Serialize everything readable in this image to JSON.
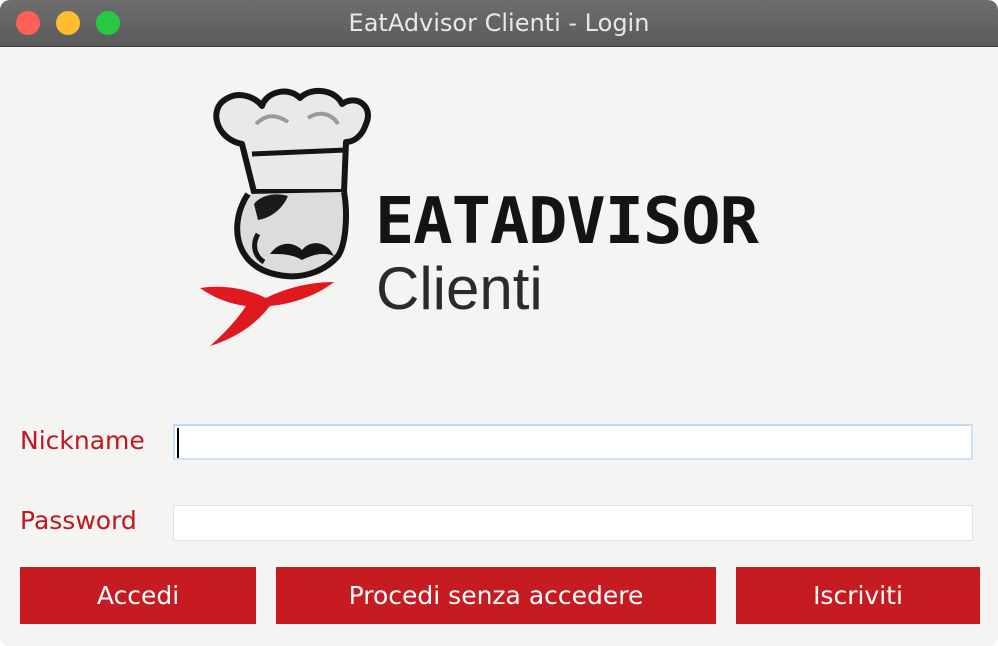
{
  "window": {
    "title": "EatAdvisor Clienti - Login"
  },
  "logo": {
    "title": "EATADVISOR",
    "subtitle": "Clienti",
    "colors": {
      "accent_red": "#e0191f",
      "ink": "#141414"
    }
  },
  "form": {
    "nickname_label": "Nickname",
    "nickname_value": "",
    "password_label": "Password",
    "password_value": ""
  },
  "buttons": {
    "login_label": "Accedi",
    "guest_label": "Procedi senza accedere",
    "signup_label": "Iscriviti"
  },
  "colors": {
    "button_bg": "#c71b22",
    "label_text": "#c0171d",
    "window_bg": "#f4f4f3"
  }
}
